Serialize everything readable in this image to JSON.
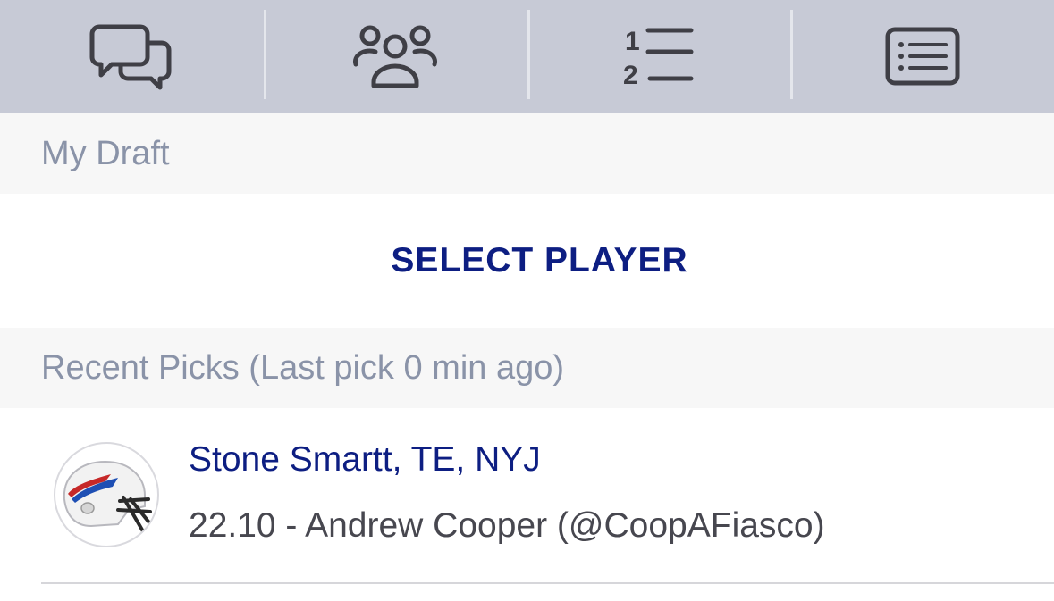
{
  "tabs": [
    {
      "icon": "chat-icon"
    },
    {
      "icon": "users-icon"
    },
    {
      "icon": "ordered-list-icon",
      "glyph_top": "1",
      "glyph_bottom": "2"
    },
    {
      "icon": "list-card-icon"
    }
  ],
  "my_draft": {
    "header": "My Draft",
    "select_button": "SELECT PLAYER"
  },
  "recent_picks": {
    "header": "Recent Picks (Last pick 0 min ago)",
    "items": [
      {
        "avatar_icon": "helmet-icon",
        "title": "Stone Smartt, TE, NYJ",
        "subtitle": "22.10 - Andrew Cooper (@CoopAFiasco)"
      }
    ]
  },
  "colors": {
    "tabbar_bg": "#c7cad6",
    "icon": "#3f3f46",
    "header_text": "#8a93a8",
    "accent_navy": "#0d1e82",
    "body_text": "#47474f"
  }
}
